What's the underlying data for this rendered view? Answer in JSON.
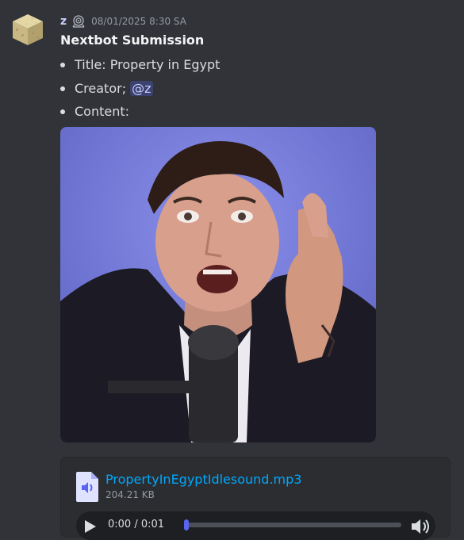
{
  "message": {
    "author": "z",
    "timestamp": "08/01/2025 8:30 SA",
    "title": "Nextbot Submission",
    "fields": {
      "title_line": "Title: Property in Egypt",
      "creator_prefix": "Creator;",
      "creator_mention": "@z",
      "content_label": "Content:"
    }
  },
  "attachment": {
    "file_name": "PropertyInEgyptIdlesound.mp3",
    "file_size": "204.21 KB",
    "player": {
      "time": "0:00 / 0:01",
      "progress": 0
    }
  },
  "icons": {
    "avatar": "sand-cube-avatar",
    "badge": "hypesquad-badge-icon",
    "file": "audio-file-icon",
    "play": "play-icon",
    "volume": "volume-icon"
  },
  "colors": {
    "background": "#313338",
    "username": "#c9cdfb",
    "link": "#00a8fc",
    "mention_bg": "#3c4270",
    "accent": "#5865f2"
  }
}
